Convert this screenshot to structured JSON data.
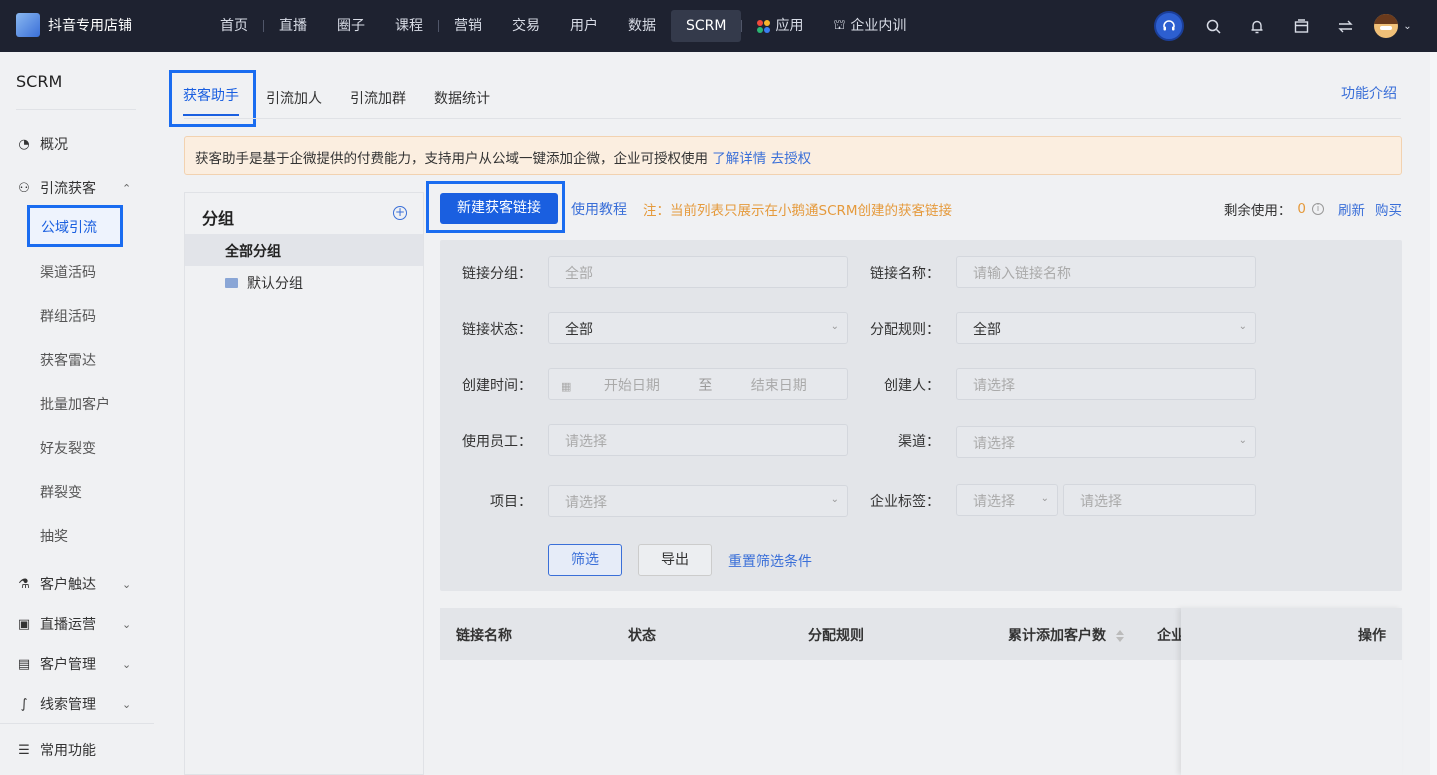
{
  "topbar": {
    "shop_name": "抖音专用店铺",
    "nav": [
      "首页",
      "直播",
      "圈子",
      "课程",
      "营销",
      "交易",
      "用户",
      "数据",
      "SCRM",
      "应用",
      "企业内训"
    ],
    "active_nav": "SCRM",
    "icons": [
      "headset-icon",
      "search-icon",
      "bell-icon",
      "store-icon",
      "switch-icon",
      "avatar-icon"
    ]
  },
  "sidebar": {
    "title": "SCRM",
    "overview": "概况",
    "lead_gen": "引流获客",
    "subitems": [
      "公域引流",
      "渠道活码",
      "群组活码",
      "获客雷达",
      "批量加客户",
      "好友裂变",
      "群裂变",
      "抽奖"
    ],
    "active_sub": "公域引流",
    "groups": [
      "客户触达",
      "直播运营",
      "客户管理",
      "线索管理"
    ],
    "common": "常用功能"
  },
  "tabs": {
    "items": [
      "获客助手",
      "引流加人",
      "引流加群",
      "数据统计"
    ],
    "active": "获客助手",
    "intro": "功能介绍"
  },
  "notice": {
    "text": "获客助手是基于企微提供的付费能力，支持用户从公域一键添加企微，企业可授权使用",
    "link1": "了解详情",
    "link2": "去授权"
  },
  "groups": {
    "title": "分组",
    "all": "全部分组",
    "default": "默认分组"
  },
  "toolbar": {
    "new_button": "新建获客链接",
    "tutorial": "使用教程",
    "note": "注：当前列表只展示在小鹅通SCRM创建的获客链接",
    "remain_label": "剩余使用：",
    "remain_value": "0",
    "refresh": "刷新",
    "buy": "购买"
  },
  "filters": {
    "link_group_label": "链接分组：",
    "link_group_placeholder": "全部",
    "link_name_label": "链接名称：",
    "link_name_placeholder": "请输入链接名称",
    "status_label": "链接状态：",
    "status_value": "全部",
    "rule_label": "分配规则：",
    "rule_value": "全部",
    "created_label": "创建时间：",
    "start_placeholder": "开始日期",
    "to": "至",
    "end_placeholder": "结束日期",
    "creator_label": "创建人：",
    "creator_placeholder": "请选择",
    "staff_label": "使用员工：",
    "staff_placeholder": "请选择",
    "channel_label": "渠道：",
    "channel_placeholder": "请选择",
    "project_label": "项目：",
    "project_placeholder": "请选择",
    "tag_label": "企业标签：",
    "tag_placeholder1": "请选择",
    "tag_placeholder2": "请选择",
    "filter_button": "筛选",
    "export_button": "导出",
    "reset_link": "重置筛选条件"
  },
  "table": {
    "headers": [
      "链接名称",
      "状态",
      "分配规则",
      "累计添加客户数",
      "企业",
      "操作"
    ]
  }
}
